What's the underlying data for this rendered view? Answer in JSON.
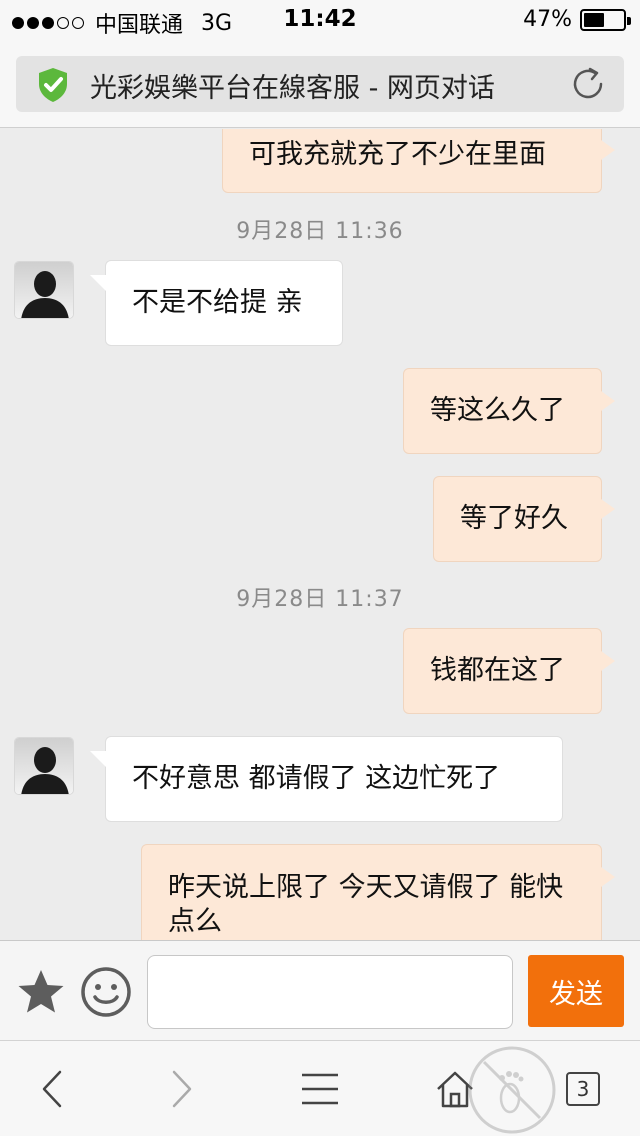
{
  "status_bar": {
    "carrier": "中国联通",
    "network": "3G",
    "time": "11:42",
    "battery": "47%",
    "battery_level": 0.47,
    "signal_bars_on": 3,
    "signal_bars_total": 5
  },
  "browser": {
    "page_title": "光彩娛樂平台在線客服 - 网页对话",
    "secure_icon": "shield-check-icon",
    "refresh_icon": "refresh-icon"
  },
  "chat": {
    "messages": [
      {
        "from": "me",
        "text": "可我充就充了不少在里面"
      },
      {
        "type": "time",
        "text": "9月28日 11:36"
      },
      {
        "from": "them",
        "text": "不是不给提 亲"
      },
      {
        "from": "me",
        "text": "等这么久了"
      },
      {
        "from": "me",
        "text": "等了好久"
      },
      {
        "type": "time",
        "text": "9月28日 11:37"
      },
      {
        "from": "me",
        "text": "钱都在这了"
      },
      {
        "from": "them",
        "text": "不好意思 都请假了 这边忙死了"
      },
      {
        "from": "me",
        "text": "昨天说上限了 今天又请假了 能快点么"
      }
    ]
  },
  "input_bar": {
    "star_icon": "star-icon",
    "emoji_icon": "smile-icon",
    "message_value": "",
    "send_label": "发送"
  },
  "bottom_nav": {
    "back_icon": "chevron-left-icon",
    "forward_icon": "chevron-right-icon",
    "menu_icon": "menu-icon",
    "home_icon": "home-icon",
    "tab_count": "3"
  },
  "colors": {
    "accent": "#f2700c",
    "my_bubble": "#fde8d7",
    "their_bubble": "#ffffff",
    "secure_green": "#5cb83c"
  }
}
